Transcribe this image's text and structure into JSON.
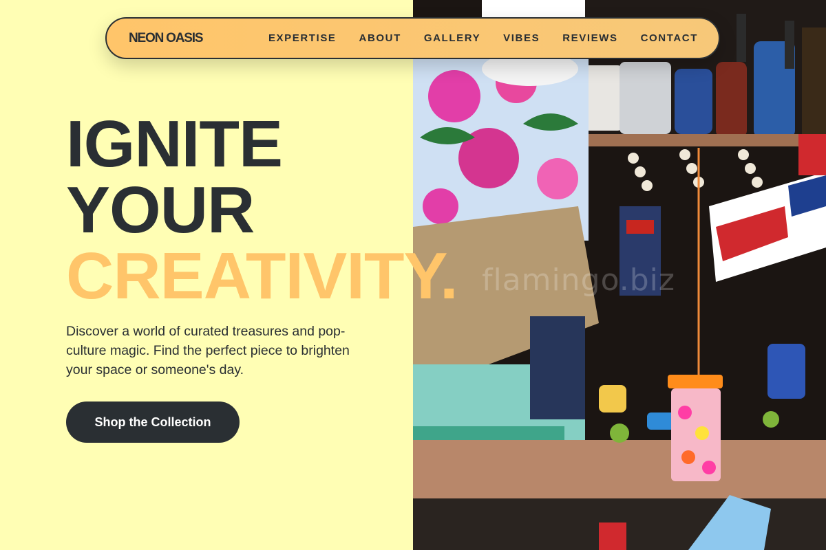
{
  "brand": {
    "name": "NEON OASIS"
  },
  "nav": {
    "links": [
      {
        "label": "EXPERTISE"
      },
      {
        "label": "ABOUT"
      },
      {
        "label": "GALLERY"
      },
      {
        "label": "VIBES"
      },
      {
        "label": "REVIEWS"
      },
      {
        "label": "CONTACT"
      }
    ]
  },
  "hero": {
    "title_lines": [
      "IGNITE",
      "YOUR",
      "CREATIVITY."
    ],
    "description": "Discover a world of curated treasures and pop-culture magic. Find the perfect piece to brighten your space or someone's day.",
    "cta_label": "Shop the Collection",
    "image_watermark": "flamingo.biz"
  },
  "colors": {
    "background": "#FFFEB4",
    "accent": "#FFC56A",
    "text_dark": "#2A2F33",
    "button_text": "#FFFFFF"
  }
}
